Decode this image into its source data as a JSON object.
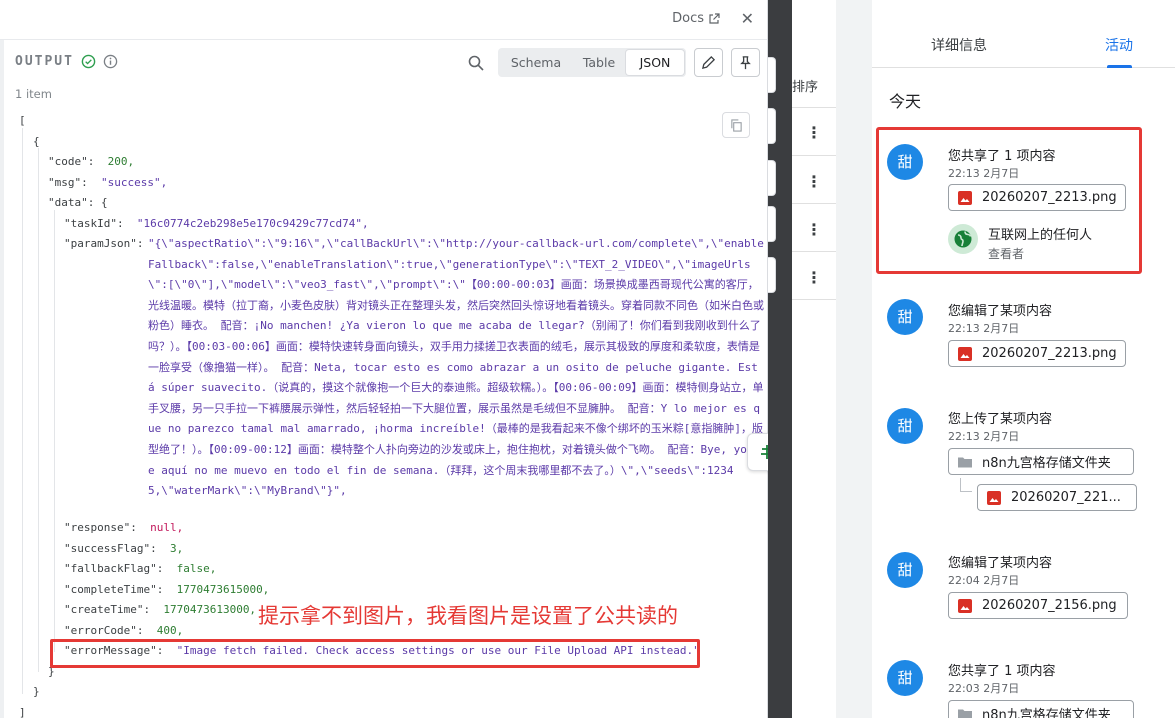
{
  "topbar": {
    "docs_label": "Docs",
    "close_label": "✕"
  },
  "output": {
    "title": "OUTPUT",
    "views": [
      "Schema",
      "Table",
      "JSON"
    ],
    "active_view": "JSON",
    "item_count": "1 item"
  },
  "json_lines": {
    "open_bracket": "[",
    "open_brace": "{",
    "code_key": "\"code\":",
    "code_val": "200,",
    "msg_key": "\"msg\":",
    "msg_val": "\"success\",",
    "data_key": "\"data\":",
    "data_open": "{",
    "taskId_key": "\"taskId\":",
    "taskId_val": "\"16c0774c2eb298e5e170c9429c77cd74\",",
    "paramJson_key": "\"paramJson\":",
    "paramJson_val": "\"{\\\"aspectRatio\\\":\\\"9:16\\\",\\\"callBackUrl\\\":\\\"http://your-callback-url.com/complete\\\",\\\"enableFallback\\\":false,\\\"enableTranslation\\\":true,\\\"generationType\\\":\\\"TEXT_2_VIDEO\\\",\\\"imageUrls\\\":[\\\"0\\\"],\\\"model\\\":\\\"veo3_fast\\\",\\\"prompt\\\":\\\"【00:00-00:03】画面：场景换成墨西哥现代公寓的客厅，光线温暖。模特（拉丁裔，小麦色皮肤）背对镜头正在整理头发，然后突然回头惊讶地看着镜头。穿着同款不同色（如米白色或粉色）睡衣。 配音：¡No manchen! ¿Ya vieron lo que me acaba de llegar?（别闹了！你们看到我刚收到什么了吗？）。【00:03-00:06】画面：模特快速转身面向镜头，双手用力揉搓卫衣表面的绒毛，展示其极致的厚度和柔软度，表情是一脸享受（像撸猫一样）。 配音：Neta, tocar esto es como abrazar a un osito de peluche gigante. Está súper suavecito.（说真的，摸这个就像抱一个巨大的泰迪熊。超级软糯。）。【00:06-00:09】画面：模特侧身站立，单手叉腰，另一只手拉一下裤腰展示弹性，然后轻轻拍一下大腿位置，展示虽然是毛绒但不显臃肿。 配音：Y lo mejor es que no parezco tamal mal amarrado, ¡horma increíble!（最棒的是我看起来不像个绑坏的玉米粽[意指臃肿]，版型绝了！）。【00:09-00:12】画面：模特整个人扑向旁边的沙发或床上，抱住抱枕，对着镜头做个飞吻。 配音：Bye, yo de aquí no me muevo en todo el fin de semana.（拜拜，这个周末我哪里都不去了。）\\\",\\\"seeds\\\":12345,\\\"waterMark\\\":\\\"MyBrand\\\"}\",",
    "response_key": "\"response\":",
    "response_val": "null,",
    "successFlag_key": "\"successFlag\":",
    "successFlag_val": "3,",
    "fallbackFlag_key": "\"fallbackFlag\":",
    "fallbackFlag_val": "false,",
    "completeTime_key": "\"completeTime\":",
    "completeTime_val": "1770473615000,",
    "createTime_key": "\"createTime\":",
    "createTime_val": "1770473613000,",
    "errorCode_key": "\"errorCode\":",
    "errorCode_val": "400,",
    "errorMessage_key": "\"errorMessage\":",
    "errorMessage_val": "\"Image fetch failed. Check access settings or use our File Upload API instead.\"",
    "data_close": "}",
    "close_brace": "}",
    "close_bracket": "]"
  },
  "annotation": "提示拿不到图片，我看图片是设置了公共读的",
  "middle": {
    "sort_label": "排序"
  },
  "activity": {
    "tabs": [
      "详细信息",
      "活动"
    ],
    "section": "今天",
    "avatar_char": "甜",
    "items": [
      {
        "title": "您共享了 1 项内容",
        "time": "22:13 2月7日",
        "file": "20260207_2213.png",
        "share_target": "互联网上的任何人",
        "share_role": "查看者"
      },
      {
        "title": "您编辑了某项内容",
        "time": "22:13 2月7日",
        "file": "20260207_2213.png"
      },
      {
        "title": "您上传了某项内容",
        "time": "22:13 2月7日",
        "folder": "n8n九宫格存储文件夹",
        "file": "20260207_221..."
      },
      {
        "title": "您编辑了某项内容",
        "time": "22:04 2月7日",
        "file": "20260207_2156.png"
      },
      {
        "title": "您共享了 1 项内容",
        "time": "22:03 2月7日",
        "folder": "n8n九宫格存储文件夹"
      }
    ]
  },
  "colors": {
    "accent": "#1a73e8",
    "annotation": "#e53935",
    "avatar": "#1e88e5",
    "image_icon": "#d93025",
    "globe_icon": "#188038"
  }
}
